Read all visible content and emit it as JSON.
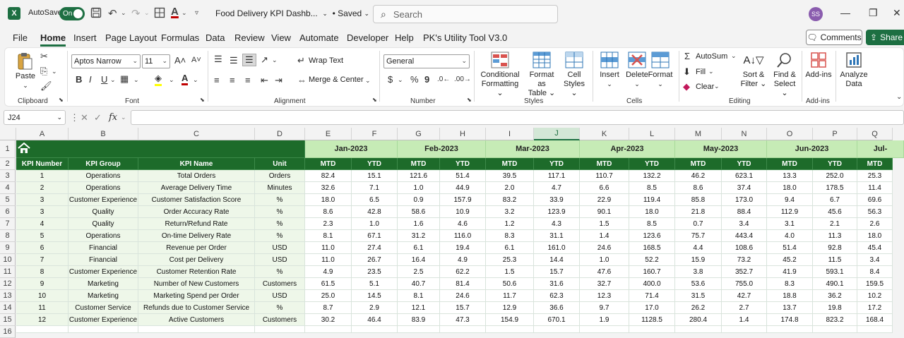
{
  "titlebar": {
    "autosave_label": "AutoSave",
    "autosave_state": "On",
    "doc_title": "Food Delivery KPI Dashb...",
    "saved_status": "• Saved",
    "search_placeholder": "Search",
    "avatar_initials": "SS"
  },
  "menu": [
    "File",
    "Home",
    "Insert",
    "Page Layout",
    "Formulas",
    "Data",
    "Review",
    "View",
    "Automate",
    "Developer",
    "Help",
    "PK's Utility Tool V3.0"
  ],
  "menu_active": "Home",
  "actions": {
    "comments": "Comments",
    "share": "Share"
  },
  "ribbon": {
    "clipboard": {
      "label": "Clipboard",
      "paste": "Paste"
    },
    "font": {
      "label": "Font",
      "name": "Aptos Narrow",
      "size": "11"
    },
    "alignment": {
      "label": "Alignment",
      "wrap_text": "Wrap Text",
      "merge_center": "Merge & Center"
    },
    "number": {
      "label": "Number",
      "format": "General"
    },
    "styles": {
      "label": "Styles",
      "conditional_1": "Conditional",
      "conditional_2": "Formatting",
      "format_table_1": "Format as",
      "format_table_2": "Table",
      "cell_styles_1": "Cell",
      "cell_styles_2": "Styles"
    },
    "cells": {
      "label": "Cells",
      "insert": "Insert",
      "delete": "Delete",
      "format": "Format"
    },
    "editing": {
      "label": "Editing",
      "autosum": "AutoSum",
      "fill": "Fill",
      "clear": "Clear",
      "sort_1": "Sort &",
      "sort_2": "Filter",
      "find_1": "Find &",
      "find_2": "Select"
    },
    "addins": {
      "label": "Add-ins",
      "addins_btn": "Add-ins"
    },
    "analyze": {
      "line1": "Analyze",
      "line2": "Data"
    }
  },
  "formula_bar": {
    "name_box": "J24",
    "fx": "fx",
    "content": ""
  },
  "columns": [
    "A",
    "B",
    "C",
    "D",
    "E",
    "F",
    "G",
    "H",
    "I",
    "J",
    "K",
    "L",
    "M",
    "N",
    "O",
    "P",
    "Q"
  ],
  "selected_column": "J",
  "rows": [
    "1",
    "2",
    "3",
    "4",
    "5",
    "6",
    "7",
    "8",
    "9",
    "10",
    "11",
    "12",
    "13",
    "14",
    "15",
    "16"
  ],
  "sheet": {
    "months": [
      "Jan-2023",
      "Feb-2023",
      "Mar-2023",
      "Apr-2023",
      "May-2023",
      "Jun-2023",
      "Jul-"
    ],
    "headers": [
      "KPI Number",
      "KPI Group",
      "KPI Name",
      "Unit"
    ],
    "mtd": "MTD",
    "ytd": "YTD",
    "data": [
      [
        "1",
        "Operations",
        "Total Orders",
        "Orders",
        "82.4",
        "15.1",
        "121.6",
        "51.4",
        "39.5",
        "117.1",
        "110.7",
        "132.2",
        "46.2",
        "623.1",
        "13.3",
        "252.0",
        "25.3"
      ],
      [
        "2",
        "Operations",
        "Average Delivery Time",
        "Minutes",
        "32.6",
        "7.1",
        "1.0",
        "44.9",
        "2.0",
        "4.7",
        "6.6",
        "8.5",
        "8.6",
        "37.4",
        "18.0",
        "178.5",
        "11.4"
      ],
      [
        "3",
        "Customer Experience",
        "Customer Satisfaction Score",
        "%",
        "18.0",
        "6.5",
        "0.9",
        "157.9",
        "83.2",
        "33.9",
        "22.9",
        "119.4",
        "85.8",
        "173.0",
        "9.4",
        "6.7",
        "69.6"
      ],
      [
        "3",
        "Quality",
        "Order Accuracy Rate",
        "%",
        "8.6",
        "42.8",
        "58.6",
        "10.9",
        "3.2",
        "123.9",
        "90.1",
        "18.0",
        "21.8",
        "88.4",
        "112.9",
        "45.6",
        "56.3"
      ],
      [
        "4",
        "Quality",
        "Return/Refund Rate",
        "%",
        "2.3",
        "1.0",
        "1.6",
        "4.6",
        "1.2",
        "4.3",
        "1.5",
        "8.5",
        "0.7",
        "3.4",
        "3.1",
        "2.1",
        "2.6"
      ],
      [
        "5",
        "Operations",
        "On-time Delivery Rate",
        "%",
        "8.1",
        "67.1",
        "31.2",
        "116.0",
        "8.3",
        "31.1",
        "1.4",
        "123.6",
        "75.7",
        "443.4",
        "4.0",
        "11.3",
        "18.0"
      ],
      [
        "6",
        "Financial",
        "Revenue per Order",
        "USD",
        "11.0",
        "27.4",
        "6.1",
        "19.4",
        "6.1",
        "161.0",
        "24.6",
        "168.5",
        "4.4",
        "108.6",
        "51.4",
        "92.8",
        "45.4"
      ],
      [
        "7",
        "Financial",
        "Cost per Delivery",
        "USD",
        "11.0",
        "26.7",
        "16.4",
        "4.9",
        "25.3",
        "14.4",
        "1.0",
        "52.2",
        "15.9",
        "73.2",
        "45.2",
        "11.5",
        "3.4"
      ],
      [
        "8",
        "Customer Experience",
        "Customer Retention Rate",
        "%",
        "4.9",
        "23.5",
        "2.5",
        "62.2",
        "1.5",
        "15.7",
        "47.6",
        "160.7",
        "3.8",
        "352.7",
        "41.9",
        "593.1",
        "8.4"
      ],
      [
        "9",
        "Marketing",
        "Number of New Customers",
        "Customers",
        "61.5",
        "5.1",
        "40.7",
        "81.4",
        "50.6",
        "31.6",
        "32.7",
        "400.0",
        "53.6",
        "755.0",
        "8.3",
        "490.1",
        "159.5"
      ],
      [
        "10",
        "Marketing",
        "Marketing Spend per Order",
        "USD",
        "25.0",
        "14.5",
        "8.1",
        "24.6",
        "11.7",
        "62.3",
        "12.3",
        "71.4",
        "31.5",
        "42.7",
        "18.8",
        "36.2",
        "10.2"
      ],
      [
        "11",
        "Customer Service",
        "Refunds due to Customer Service",
        "%",
        "8.7",
        "2.9",
        "12.1",
        "15.7",
        "12.9",
        "36.6",
        "9.7",
        "17.0",
        "26.2",
        "2.7",
        "13.7",
        "19.8",
        "17.2"
      ],
      [
        "12",
        "Customer Experience",
        "Active Customers",
        "Customers",
        "30.2",
        "46.4",
        "83.9",
        "47.3",
        "154.9",
        "670.1",
        "1.9",
        "1128.5",
        "280.4",
        "1.4",
        "174.8",
        "823.2",
        "168.4"
      ]
    ]
  }
}
